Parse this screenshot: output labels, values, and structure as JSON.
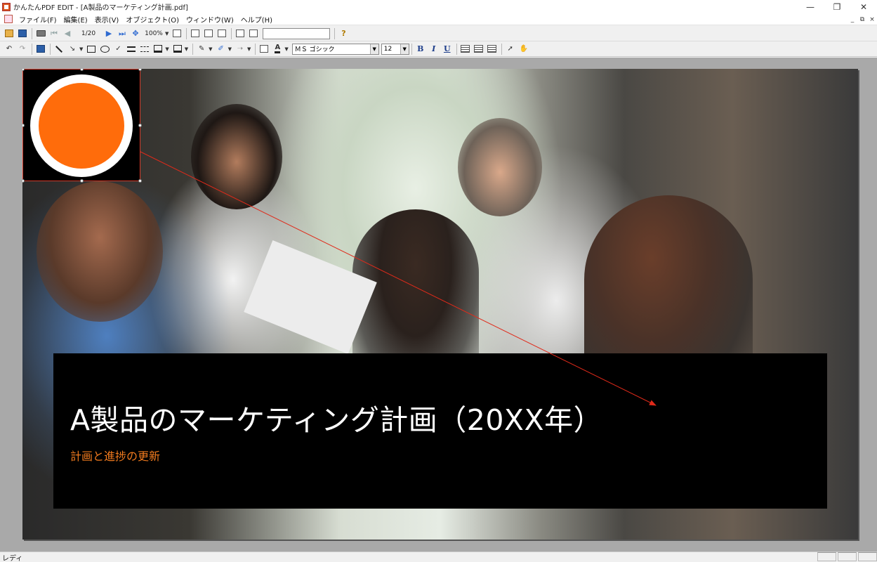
{
  "window": {
    "title": "かんたんPDF EDIT - [A製品のマーケティング計画.pdf]",
    "minimize": "—",
    "restore": "❐",
    "close": "✕"
  },
  "menu": {
    "items": [
      {
        "label": "ファイル(F)"
      },
      {
        "label": "編集(E)"
      },
      {
        "label": "表示(V)"
      },
      {
        "label": "オブジェクト(O)"
      },
      {
        "label": "ウィンドウ(W)"
      },
      {
        "label": "ヘルプ(H)"
      }
    ],
    "mdi_minimize": "_",
    "mdi_restore": "⧉",
    "mdi_close": "×"
  },
  "toolbar1": {
    "page_indicator": "1/20",
    "zoom": "100%",
    "search_value": "",
    "help_label": "?"
  },
  "toolbar2": {
    "font_name": "ＭＳ ゴシック",
    "font_size": "12",
    "bold_label": "B",
    "italic_label": "I",
    "underline_label": "U"
  },
  "slide": {
    "title": "A製品のマーケティング計画（20XX年）",
    "subtitle": "計画と進捗の更新",
    "logo_ring_color": "#ffffff",
    "logo_disc_color": "#ff6c0b",
    "accent_color": "#f07a1e",
    "arrow_color": "#e02a1a"
  },
  "status": {
    "text": "レディ"
  }
}
